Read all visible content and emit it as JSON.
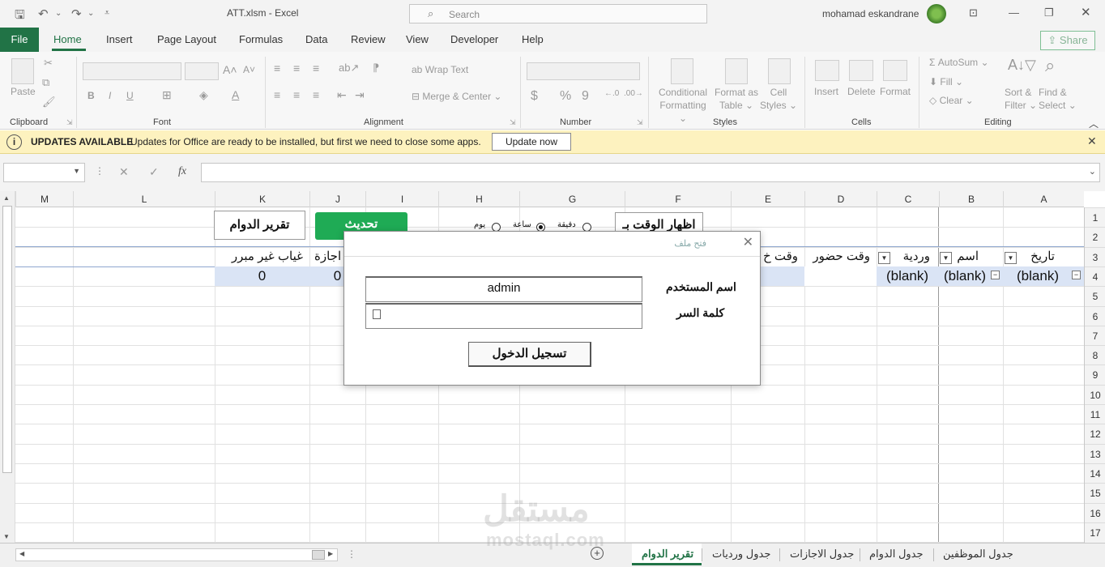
{
  "window": {
    "doc_title": "ATT.xlsm  -  Excel",
    "search_placeholder": "Search",
    "user_name": "mohamad eskandrane"
  },
  "menu": {
    "file": "File",
    "tabs": [
      "Home",
      "Insert",
      "Page Layout",
      "Formulas",
      "Data",
      "Review",
      "View",
      "Developer",
      "Help"
    ],
    "share": "Share"
  },
  "ribbon": {
    "clipboard": {
      "paste": "Paste",
      "label": "Clipboard"
    },
    "font": {
      "label": "Font",
      "bold": "B",
      "italic": "I",
      "underline": "U"
    },
    "alignment": {
      "label": "Alignment",
      "wrap_text": "Wrap Text",
      "merge_center": "Merge & Center"
    },
    "number": {
      "label": "Number",
      "currency": "$",
      "percent": "%",
      "comma": "9"
    },
    "styles": {
      "label": "Styles",
      "conditional_1": "Conditional",
      "conditional_2": "Formatting",
      "format_table_1": "Format as",
      "format_table_2": "Table",
      "cell_styles_1": "Cell",
      "cell_styles_2": "Styles"
    },
    "cells": {
      "label": "Cells",
      "insert": "Insert",
      "delete": "Delete",
      "format": "Format"
    },
    "editing": {
      "label": "Editing",
      "autosum": "AutoSum",
      "fill": "Fill",
      "clear": "Clear",
      "sort_1": "Sort &",
      "sort_2": "Filter",
      "find_1": "Find &",
      "find_2": "Select"
    }
  },
  "infobar": {
    "title": "UPDATES AVAILABLE",
    "message": "Updates for Office are ready to be installed, but first we need to close some apps.",
    "button": "Update now"
  },
  "formula_bar": {
    "fx": "fx",
    "cancel": "✕",
    "confirm": "✓"
  },
  "grid": {
    "columns": [
      "M",
      "L",
      "K",
      "J",
      "I",
      "H",
      "G",
      "F",
      "E",
      "D",
      "C",
      "B",
      "A"
    ],
    "rows": [
      "1",
      "2",
      "3",
      "4",
      "5",
      "6",
      "7",
      "8",
      "9",
      "10",
      "11",
      "12",
      "13",
      "14",
      "15",
      "16",
      "17"
    ],
    "buttons": {
      "report": "تقرير الدوام",
      "refresh": "تحديث",
      "show_time": "اظهار الوقت بـ"
    },
    "radios": [
      {
        "label": "يوم",
        "checked": false
      },
      {
        "label": "ساعة",
        "checked": true
      },
      {
        "label": "دقيقة",
        "checked": false
      }
    ],
    "headers": {
      "date": "تاريخ",
      "name": "اسم",
      "shift": "وردية",
      "check_in": "وقت حضور",
      "check_out": "وقت خ",
      "leave": "اجازة",
      "absence": "غياب غير مبرر"
    },
    "row4": {
      "date": "(blank)",
      "name": "(blank)",
      "shift": "(blank)",
      "leave": "0",
      "absence": "0"
    }
  },
  "dialog": {
    "title": "فتح ملف",
    "username_label": "اسم المستخدم",
    "username_value": "admin",
    "password_label": "كلمة السر",
    "login_button": "تسجيل الدخول"
  },
  "sheets": {
    "tabs": [
      "تقرير الدوام",
      "جدول ورديات",
      "جدول الاجازات",
      "جدول الدوام",
      "جدول الموظفين"
    ],
    "active": "تقرير الدوام"
  },
  "watermark": {
    "arabic": "مستقل",
    "latin": "mostaql.com"
  }
}
